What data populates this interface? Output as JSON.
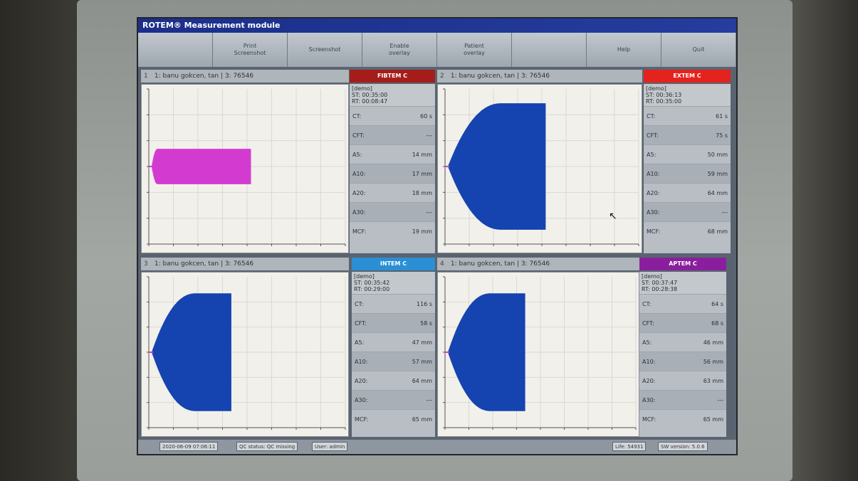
{
  "app": {
    "title": "ROTEM® Measurement module"
  },
  "toolbar": {
    "buttons": [
      {
        "label": ""
      },
      {
        "label": "Print\nScreenshot"
      },
      {
        "label": "Screenshot"
      },
      {
        "label": "Enable\noverlay"
      },
      {
        "label": "Patient\noverlay"
      },
      {
        "label": ""
      },
      {
        "label": "Help"
      },
      {
        "label": "Quit"
      }
    ]
  },
  "channels": [
    {
      "number": "1",
      "patient": "1: banu gokcen, tan | 3: 76546",
      "test": "FIBTEM C",
      "color": "#a51d1a",
      "info": [
        "[demo]",
        "ST: 00:35:00",
        "RT: 00:08:47"
      ],
      "params": [
        {
          "name": "CT:",
          "value": "60 s"
        },
        {
          "name": "CFT:",
          "value": "---"
        },
        {
          "name": "A5:",
          "value": "14 mm"
        },
        {
          "name": "A10:",
          "value": "17 mm"
        },
        {
          "name": "A20:",
          "value": "18 mm"
        },
        {
          "name": "A30:",
          "value": "---"
        },
        {
          "name": "MCF:",
          "value": "19 mm"
        }
      ],
      "trace": {
        "type": "fibtem",
        "amplitude_mm": 19,
        "color": "#d33bd0"
      }
    },
    {
      "number": "2",
      "patient": "1: banu gokcen, tan | 3: 76546",
      "test": "EXTEM C",
      "color": "#e5231e",
      "info": [
        "[demo]",
        "ST: 00:36:13",
        "RT: 00:35:00"
      ],
      "params": [
        {
          "name": "CT:",
          "value": "61 s"
        },
        {
          "name": "CFT:",
          "value": "75 s"
        },
        {
          "name": "A5:",
          "value": "50 mm"
        },
        {
          "name": "A10:",
          "value": "59 mm"
        },
        {
          "name": "A20:",
          "value": "64 mm"
        },
        {
          "name": "A30:",
          "value": "---"
        },
        {
          "name": "MCF:",
          "value": "68 mm"
        }
      ],
      "trace": {
        "type": "extem",
        "amplitude_mm": 68,
        "color": "#1544b0"
      }
    },
    {
      "number": "3",
      "patient": "1: banu gokcen, tan | 3: 76546",
      "test": "INTEM C",
      "color": "#2a8fd4",
      "info": [
        "[demo]",
        "ST: 00:35:42",
        "RT: 00:29:00"
      ],
      "params": [
        {
          "name": "CT:",
          "value": "116 s"
        },
        {
          "name": "CFT:",
          "value": "58 s"
        },
        {
          "name": "A5:",
          "value": "47 mm"
        },
        {
          "name": "A10:",
          "value": "57 mm"
        },
        {
          "name": "A20:",
          "value": "64 mm"
        },
        {
          "name": "A30:",
          "value": "---"
        },
        {
          "name": "MCF:",
          "value": "65 mm"
        }
      ],
      "trace": {
        "type": "intem",
        "amplitude_mm": 65,
        "color": "#1544b0"
      }
    },
    {
      "number": "4",
      "patient": "1: banu gokcen, tan | 3: 76546",
      "test": "APTEM C",
      "color": "#8a1f9e",
      "info": [
        "[demo]",
        "ST: 00:37:47",
        "RT: 00:28:38"
      ],
      "params": [
        {
          "name": "CT:",
          "value": "64 s"
        },
        {
          "name": "CFT:",
          "value": "68 s"
        },
        {
          "name": "A5:",
          "value": "46 mm"
        },
        {
          "name": "A10:",
          "value": "56 mm"
        },
        {
          "name": "A20:",
          "value": "63 mm"
        },
        {
          "name": "A30:",
          "value": "---"
        },
        {
          "name": "MCF:",
          "value": "65 mm"
        }
      ],
      "trace": {
        "type": "aptem",
        "amplitude_mm": 65,
        "color": "#1544b0"
      }
    }
  ],
  "statusbar": {
    "datetime": "2020-06-09 07:06:11",
    "qc": "QC status: QC missing",
    "user": "User: admin",
    "life": "Life: 54931",
    "sw": "SW version: 5.0.6"
  }
}
